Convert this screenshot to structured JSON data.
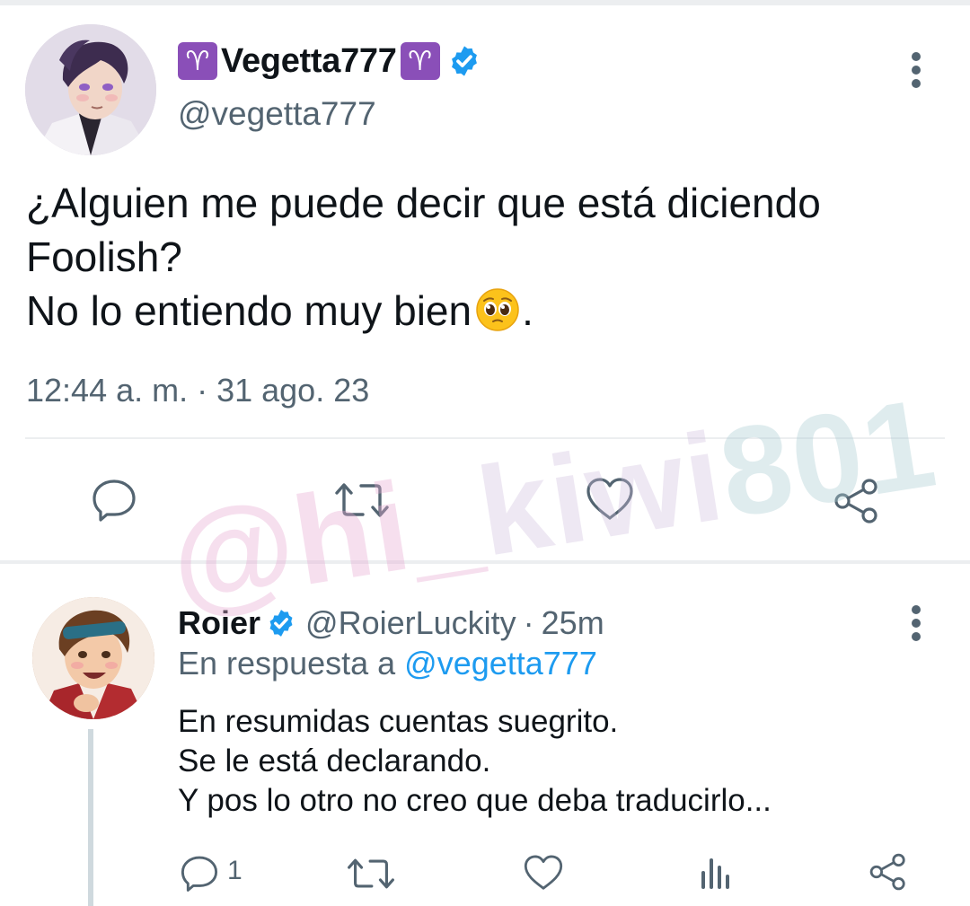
{
  "tweet": {
    "author": {
      "display_name": "Vegetta777",
      "sign_emoji": "♈",
      "handle": "@vegetta777",
      "verified": true
    },
    "text_lines": [
      "¿Alguien me puede decir que está diciendo",
      "Foolish?",
      "No lo entiendo muy bien"
    ],
    "text_end": ".",
    "emoji": "pleading-face",
    "timestamp": "12:44 a. m. · 31 ago. 23",
    "actions": [
      "reply",
      "retweet",
      "like",
      "share"
    ]
  },
  "reply": {
    "author": {
      "display_name": "Roier",
      "handle": "@RoierLuckity",
      "verified": true
    },
    "time": "25m",
    "separator": "·",
    "replying_to_prefix": "En respuesta a",
    "replying_to_mention": "@vegetta777",
    "text_lines": [
      "En resumidas cuentas suegrito.",
      "Se le está declarando.",
      "Y pos lo otro no creo que deba traducirlo..."
    ],
    "reply_count": "1",
    "actions": [
      "reply",
      "retweet",
      "like",
      "views",
      "share"
    ]
  },
  "watermark": {
    "text": "@hi_kiwi801"
  },
  "colors": {
    "text_primary": "#0f1419",
    "text_secondary": "#536471",
    "accent_blue": "#1d9bf0",
    "aries_purple": "#8a4fb8",
    "divider": "#eceef0"
  }
}
